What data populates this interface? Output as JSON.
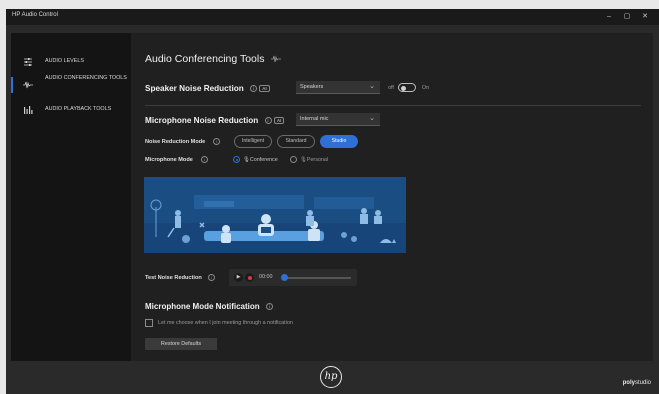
{
  "window": {
    "title": "HP Audio Control",
    "min": "–",
    "max": "▢",
    "close": "✕"
  },
  "sidebar": {
    "items": [
      {
        "label": "AUDIO LEVELS",
        "icon": "sliders-icon",
        "active": false
      },
      {
        "label": "AUDIO CONFERENCING TOOLS",
        "icon": "waveform-icon",
        "active": true
      },
      {
        "label": "AUDIO PLAYBACK TOOLS",
        "icon": "bars-icon",
        "active": false
      }
    ]
  },
  "main": {
    "title": "Audio Conferencing Tools",
    "speaker": {
      "heading": "Speaker Noise Reduction",
      "ai_badge": "AI",
      "device": "Speakers",
      "toggle_off": "off",
      "toggle_on": "On",
      "toggle_state": "off"
    },
    "mic": {
      "heading": "Microphone Noise Reduction",
      "ai_badge": "AI",
      "device": "Internal mic",
      "mode_label": "Noise Reduction Mode",
      "modes": [
        "Intelligent",
        "Standard",
        "Studio"
      ],
      "active_mode": "Studio",
      "mic_mode_label": "Microphone Mode",
      "mic_modes": [
        "Conference",
        "Personal"
      ],
      "active_mic_mode": "Conference"
    },
    "test": {
      "label": "Test Noise Reduction",
      "time": "00:00",
      "progress": 0
    },
    "notification": {
      "heading": "Microphone Mode Notification",
      "checkbox_label": "Let me choose when I join meeting through a notification",
      "checked": false
    },
    "restore_button": "Restore Defaults"
  },
  "footer": {
    "logo_text": "hp",
    "brand_left": "poly",
    "brand_right": "studio"
  },
  "colors": {
    "accent": "#2f6fd6",
    "illustration_bg": "#1a4d82",
    "panel": "#202020",
    "sidebar": "#141414"
  }
}
